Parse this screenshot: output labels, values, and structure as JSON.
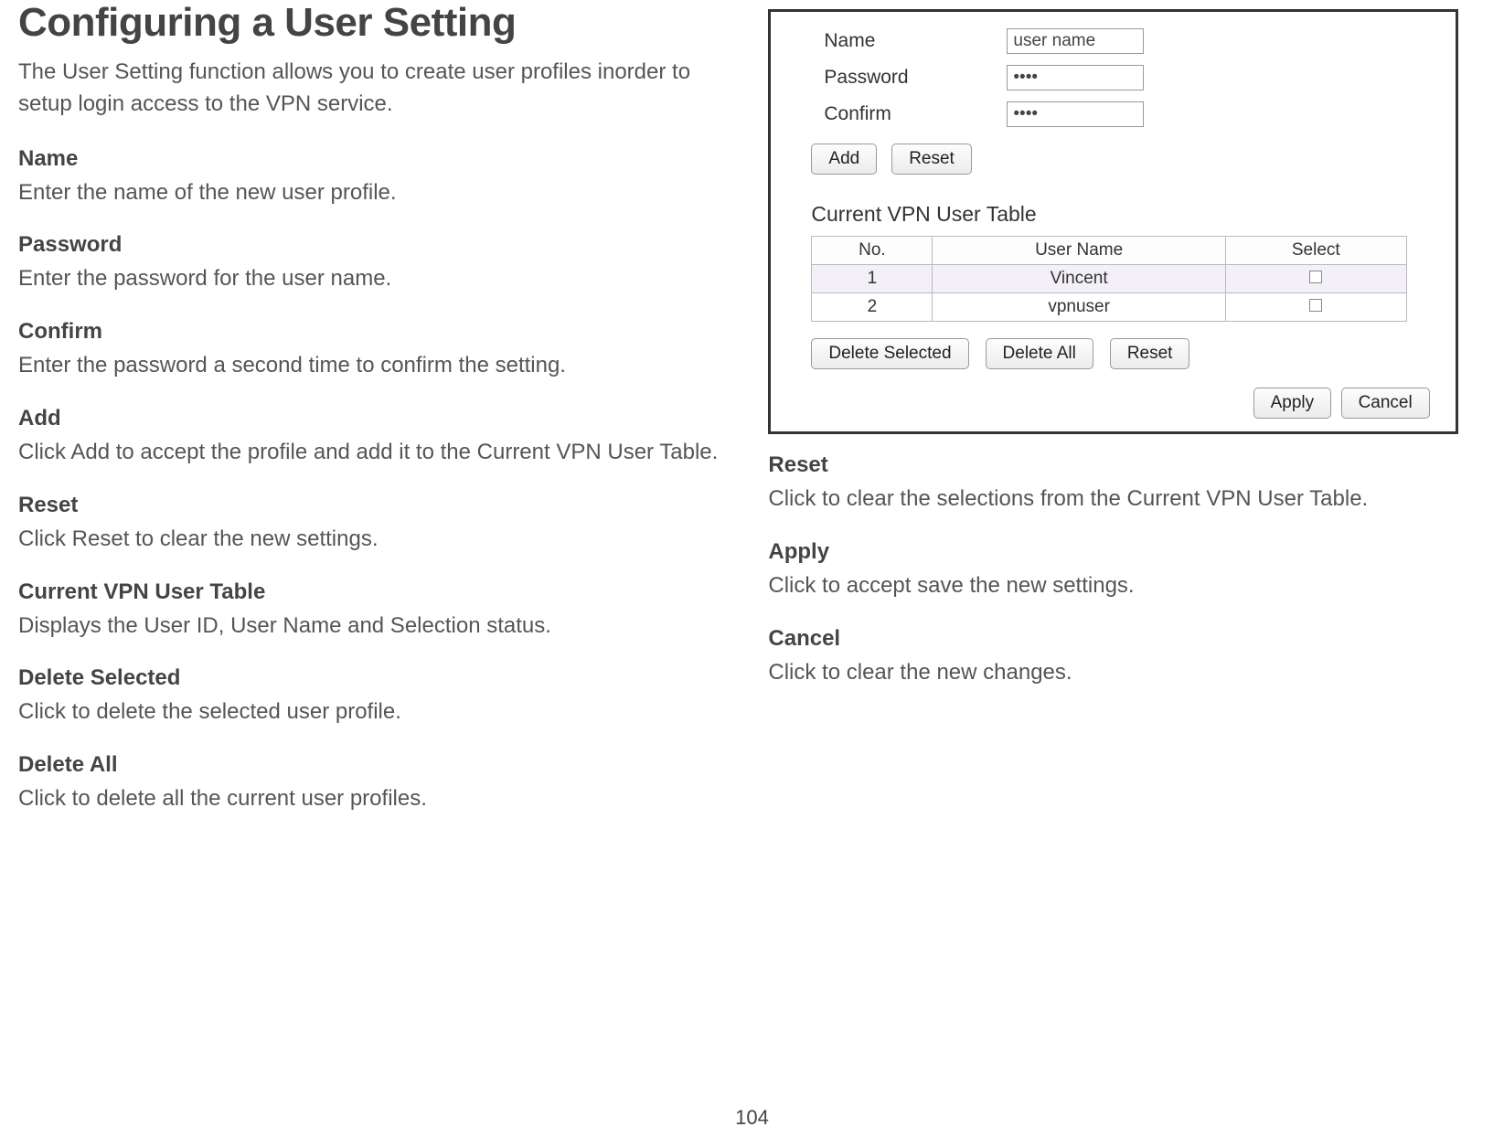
{
  "doc": {
    "title": "Configuring a User Setting",
    "intro": "The User Setting function allows you to create user profiles inorder to setup login access to the VPN service.",
    "page_number": "104"
  },
  "left": {
    "name_term": "Name",
    "name_desc": "Enter the name of the new user profile.",
    "password_term": "Password",
    "password_desc": "Enter the password for the user name.",
    "confirm_term": "Confirm",
    "confirm_desc": "Enter the password a second time to confirm the setting.",
    "add_term": "Add",
    "add_desc": "Click Add to accept the profile and add it to the Current VPN User Table.",
    "reset_term": "Reset",
    "reset_desc": "Click Reset to clear the new settings.",
    "table_term": "Current VPN User Table",
    "table_desc": "Displays the User ID, User Name and Selection status.",
    "del_sel_term": "Delete Selected",
    "del_sel_desc": "Click to delete the selected user profile.",
    "del_all_term": "Delete All",
    "del_all_desc": "Click to delete all the current user profiles."
  },
  "panel": {
    "name_label": "Name",
    "name_value": "user name",
    "password_label": "Password",
    "password_value": "••••",
    "confirm_label": "Confirm",
    "confirm_value": "••••",
    "add_btn": "Add",
    "reset_btn": "Reset",
    "table_title": "Current VPN User Table",
    "col_no": "No.",
    "col_user": "User Name",
    "col_select": "Select",
    "rows": {
      "r1_no": "1",
      "r1_user": "Vincent",
      "r2_no": "2",
      "r2_user": "vpnuser"
    },
    "del_sel_btn": "Delete Selected",
    "del_all_btn": "Delete All",
    "reset2_btn": "Reset",
    "apply_btn": "Apply",
    "cancel_btn": "Cancel"
  },
  "right": {
    "reset_term": "Reset",
    "reset_desc": "Click to clear the selections from the Current VPN User Table.",
    "apply_term": "Apply",
    "apply_desc": "Click to accept save the new settings.",
    "cancel_term": "Cancel",
    "cancel_desc": "Click to clear the new changes."
  }
}
